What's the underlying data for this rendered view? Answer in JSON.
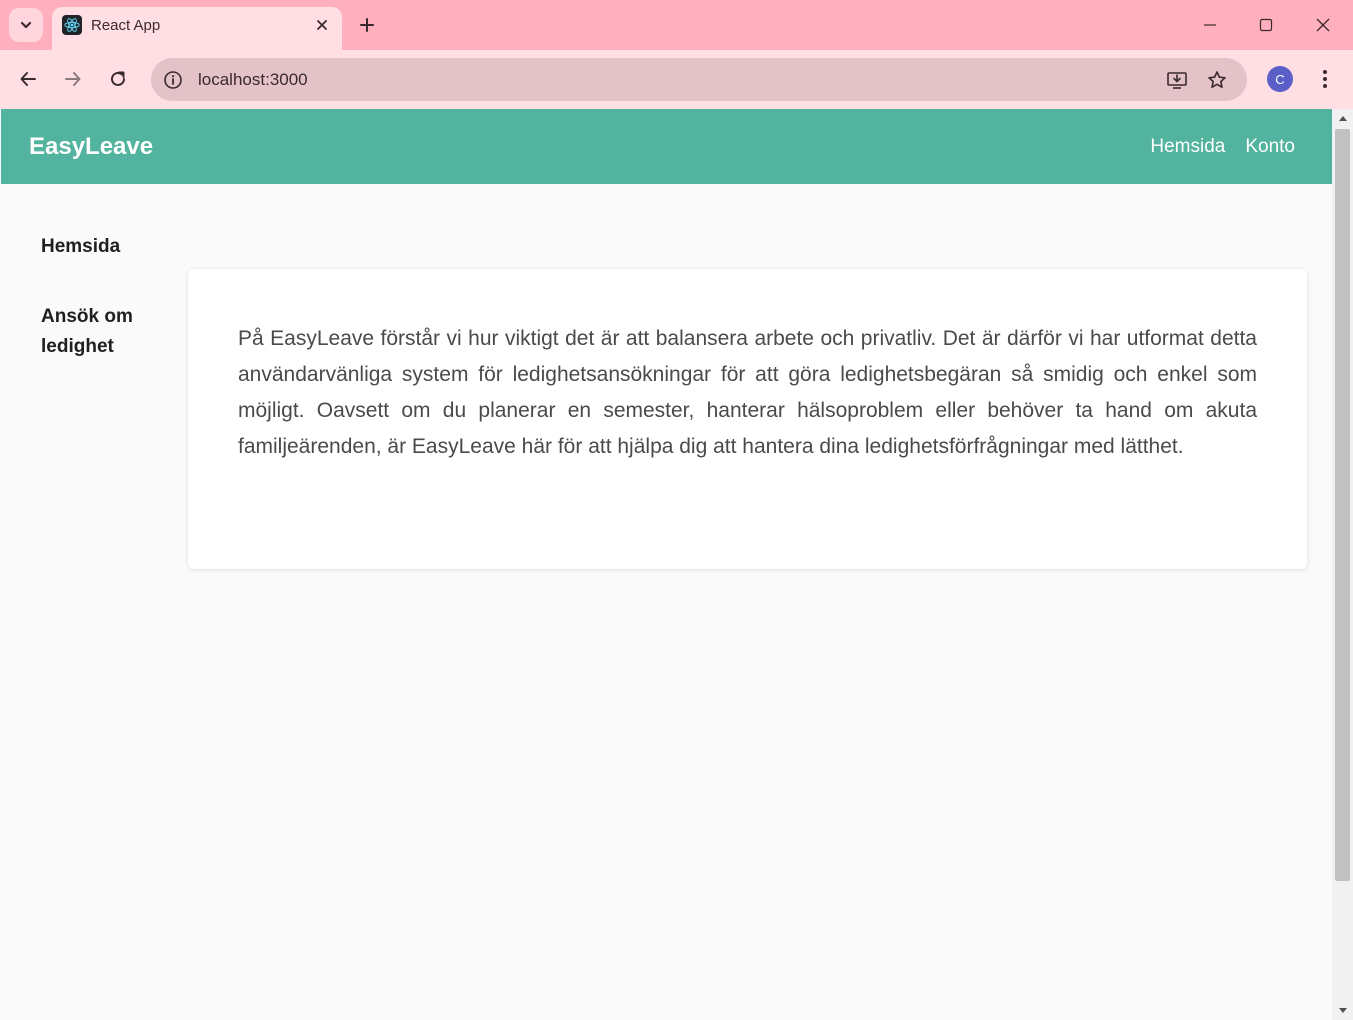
{
  "browser": {
    "tab": {
      "title": "React App"
    },
    "url": "localhost:3000",
    "profile_initial": "C",
    "icons": {
      "tab_search": "chevron-down-icon",
      "favicon": "react-icon",
      "tab_close": "close-icon",
      "new_tab": "plus-icon",
      "minimize": "minimize-icon",
      "maximize": "maximize-icon",
      "close_window": "close-icon",
      "back": "arrow-left-icon",
      "forward": "arrow-right-icon",
      "reload": "reload-icon",
      "site_info": "info-icon",
      "install": "install-icon",
      "bookmark": "star-icon",
      "menu": "kebab-menu-icon"
    },
    "colors": {
      "tabstrip": "#ffafbd",
      "toolbar": "#ffdfe4",
      "omnibox": "#e3c2c8"
    }
  },
  "app": {
    "brand": "EasyLeave",
    "header_color": "#52b39e",
    "top_nav": [
      {
        "label": "Hemsida"
      },
      {
        "label": "Konto"
      }
    ],
    "sidebar": [
      {
        "label": "Hemsida"
      },
      {
        "label": "Ansök om ledighet"
      }
    ],
    "card": {
      "text": "På EasyLeave förstår vi hur viktigt det är att balansera arbete och privatliv. Det är därför vi har utformat detta användarvänliga system för ledighetsansökningar för att göra ledighetsbegäran så smidig och enkel som möjligt. Oavsett om du planerar en semester, hanterar hälsoproblem eller behöver ta hand om akuta familjeärenden, är EasyLeave här för att hjälpa dig att hantera dina ledighetsförfrågningar med lätthet."
    }
  }
}
